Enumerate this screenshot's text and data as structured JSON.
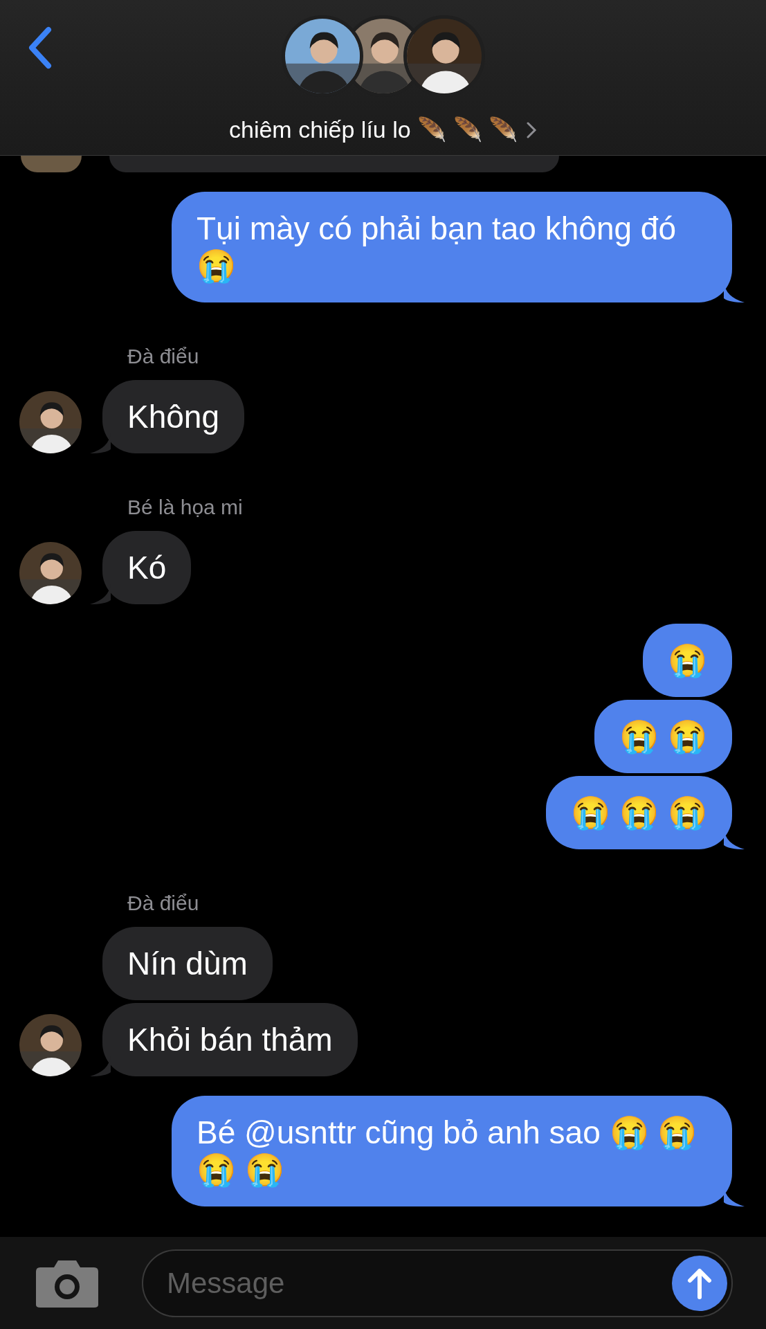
{
  "header": {
    "title": "chiêm chiếp líu lo 🪶 🪶 🪶"
  },
  "messages": [
    {
      "kind": "sent",
      "text": "Tụi mày có phải bạn tao không đó 😭",
      "tail": true
    },
    {
      "kind": "sender_label",
      "text": "Đà điểu"
    },
    {
      "kind": "received",
      "text": "Không",
      "avatar": true
    },
    {
      "kind": "sender_label",
      "text": "Bé là họa mi"
    },
    {
      "kind": "received",
      "text": "Kó",
      "avatar": true
    },
    {
      "kind": "sent",
      "text": "😭",
      "tail": false
    },
    {
      "kind": "sent",
      "text": "😭 😭",
      "tail": false
    },
    {
      "kind": "sent",
      "text": "😭 😭 😭",
      "tail": true
    },
    {
      "kind": "sender_label",
      "text": "Đà điểu"
    },
    {
      "kind": "received",
      "text": "Nín dùm",
      "avatar": false
    },
    {
      "kind": "received",
      "text": "Khỏi bán thảm",
      "avatar": true
    },
    {
      "kind": "sent",
      "text": "Bé @usnttr cũng bỏ anh sao 😭 😭 😭 😭",
      "tail": true
    }
  ],
  "composer": {
    "placeholder": "Message"
  }
}
